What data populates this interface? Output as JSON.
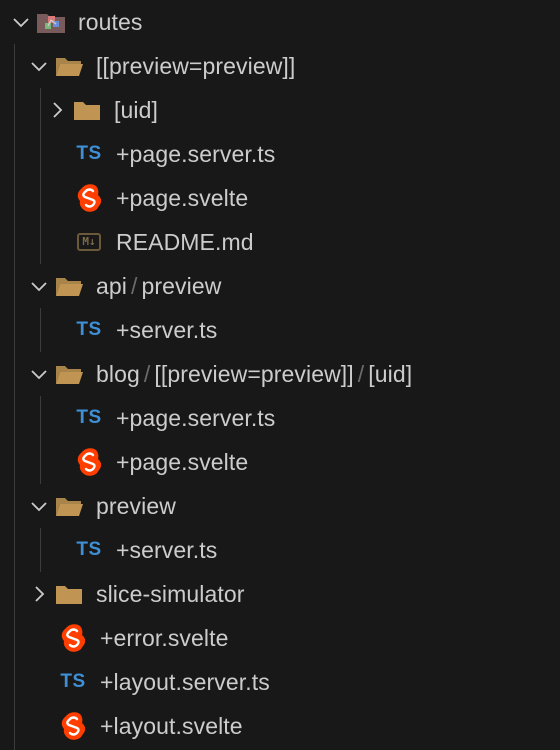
{
  "tree": [
    {
      "label": "routes",
      "type": "folder-special",
      "expanded": true
    },
    {
      "label": "[[preview=preview]]",
      "type": "folder",
      "expanded": true
    },
    {
      "label": "[uid]",
      "type": "folder",
      "expanded": false
    },
    {
      "label": "+page.server.ts",
      "type": "ts"
    },
    {
      "label": "+page.svelte",
      "type": "svelte"
    },
    {
      "label": "README.md",
      "type": "markdown"
    },
    {
      "parts": [
        "api",
        "preview"
      ],
      "type": "folder",
      "expanded": true
    },
    {
      "label": "+server.ts",
      "type": "ts"
    },
    {
      "parts": [
        "blog",
        "[[preview=preview]]",
        "[uid]"
      ],
      "type": "folder",
      "expanded": true
    },
    {
      "label": "+page.server.ts",
      "type": "ts"
    },
    {
      "label": "+page.svelte",
      "type": "svelte"
    },
    {
      "label": "preview",
      "type": "folder",
      "expanded": true
    },
    {
      "label": "+server.ts",
      "type": "ts"
    },
    {
      "label": "slice-simulator",
      "type": "folder",
      "expanded": false
    },
    {
      "label": "+error.svelte",
      "type": "svelte"
    },
    {
      "label": "+layout.server.ts",
      "type": "ts"
    },
    {
      "label": "+layout.svelte",
      "type": "svelte"
    }
  ],
  "icons": {
    "ts_text": "TS",
    "md_text": "M↓",
    "separator": "/"
  },
  "colors": {
    "background": "#181818",
    "text": "#cccccc",
    "folder": "#c09553",
    "ts": "#3f8fd6",
    "svelte": "#ff3e00"
  }
}
